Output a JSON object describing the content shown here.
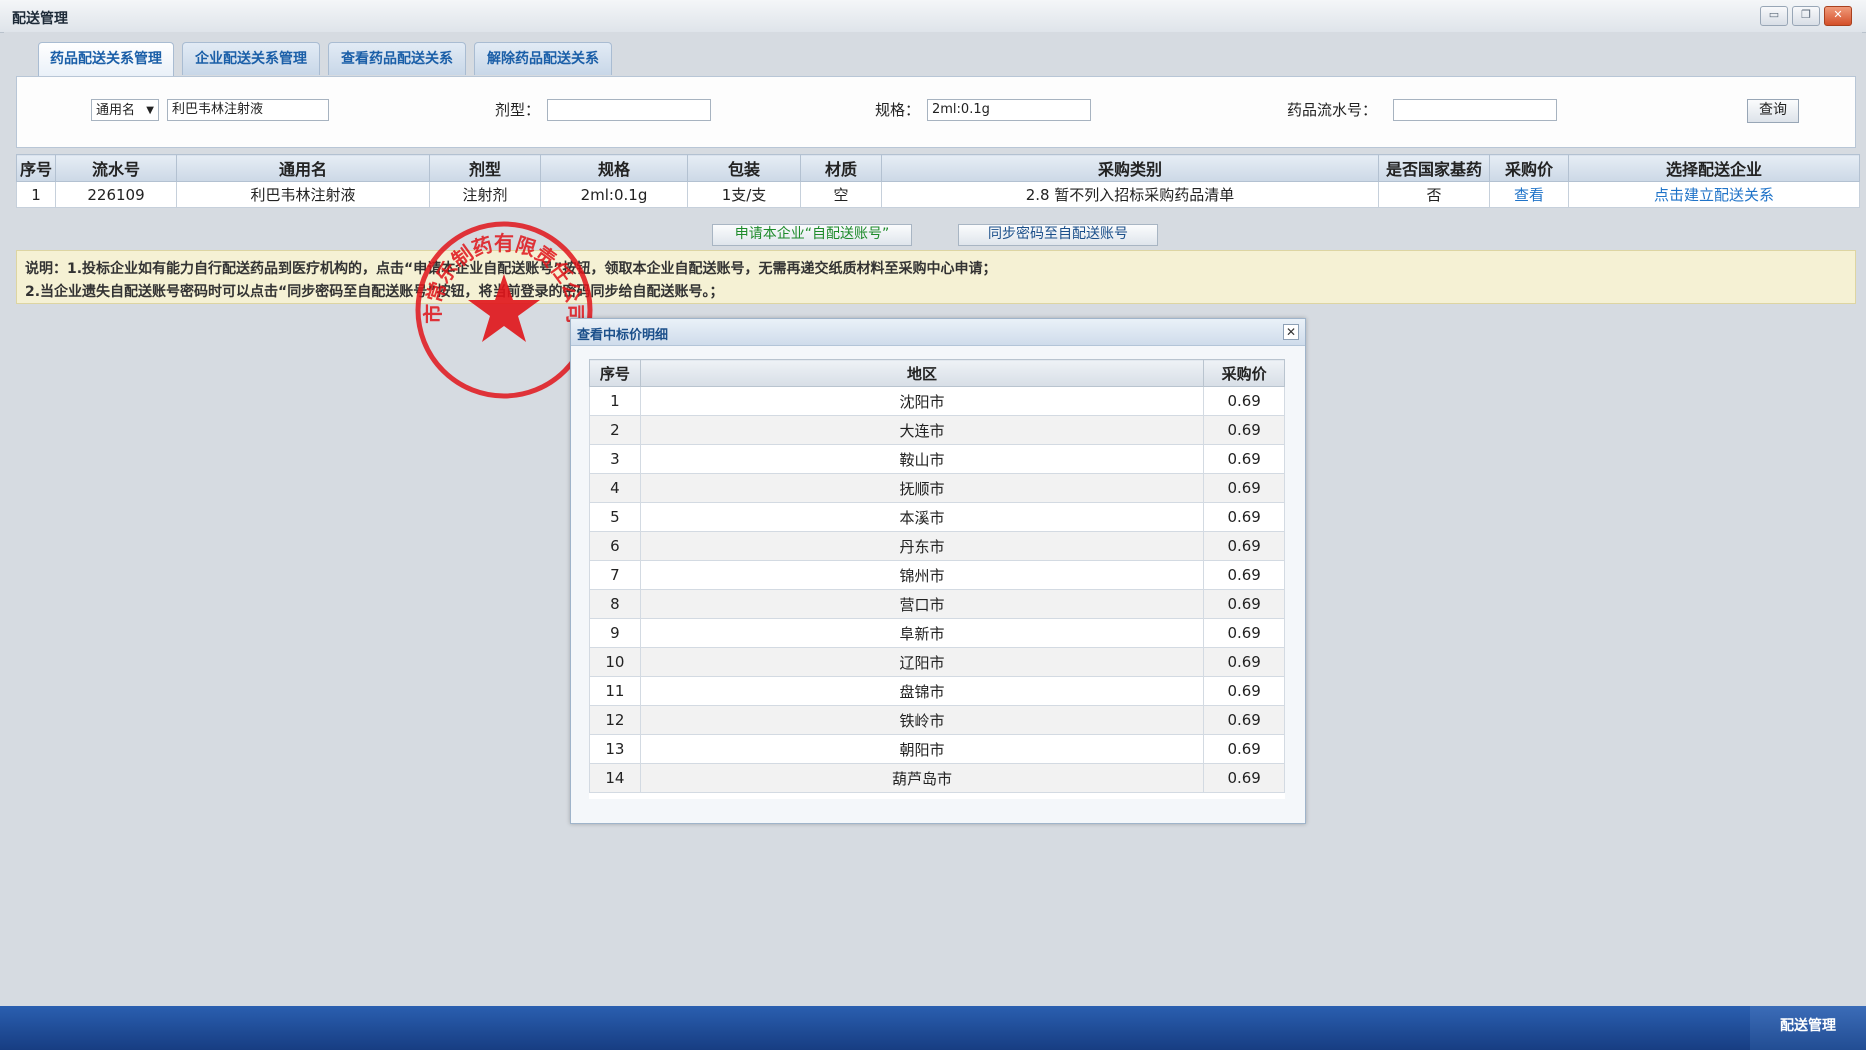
{
  "window": {
    "title": "配送管理",
    "minimize_icon": "minimize-icon",
    "maximize_icon": "maximize-icon",
    "close_icon": "close-icon"
  },
  "tabs": [
    {
      "label": "药品配送关系管理",
      "active": true
    },
    {
      "label": "企业配送关系管理",
      "active": false
    },
    {
      "label": "查看药品配送关系",
      "active": false
    },
    {
      "label": "解除药品配送关系",
      "active": false
    }
  ],
  "search": {
    "name_type_selected": "通用名",
    "name_value": "利巴韦林注射液",
    "dosage_label": "剂型：",
    "dosage_value": "",
    "spec_label": "规格：",
    "spec_value": "2ml:0.1g",
    "serial_label": "药品流水号：",
    "serial_value": "",
    "query_label": "查询"
  },
  "table": {
    "headers": [
      "序号",
      "流水号",
      "通用名",
      "剂型",
      "规格",
      "包装",
      "材质",
      "采购类别",
      "是否国家基药",
      "采购价",
      "选择配送企业"
    ],
    "rows": [
      {
        "index": "1",
        "serial": "226109",
        "name": "利巴韦林注射液",
        "dosage": "注射剂",
        "spec": "2ml:0.1g",
        "package": "1支/支",
        "material": "空",
        "category": "2.8 暂不列入招标采购药品清单",
        "basic_drug": "否",
        "price_link": "查看",
        "enterprise_link": "点击建立配送关系"
      }
    ]
  },
  "actions": {
    "apply_label": "申请本企业“自配送账号”",
    "sync_label": "同步密码至自配送账号"
  },
  "notice": {
    "line1": "说明：1.投标企业如有能力自行配送药品到医疗机构的，点击“申请本企业自配送账号”按钮，领取本企业自配送账号，无需再递交纸质材料至采购中心申请；",
    "line2": "2.当企业遗失自配送账号密码时可以点击“同步密码至自配送账号”按钮，将当前登录的密码同步给自配送账号。；"
  },
  "stamp": {
    "text": "市常乐制药有限责任公司",
    "color": "#e0141a"
  },
  "dialog": {
    "title": "查看中标价明细",
    "headers": [
      "序号",
      "地区",
      "采购价"
    ],
    "rows": [
      {
        "index": "1",
        "region": "沈阳市",
        "price": "0.69"
      },
      {
        "index": "2",
        "region": "大连市",
        "price": "0.69"
      },
      {
        "index": "3",
        "region": "鞍山市",
        "price": "0.69"
      },
      {
        "index": "4",
        "region": "抚顺市",
        "price": "0.69"
      },
      {
        "index": "5",
        "region": "本溪市",
        "price": "0.69"
      },
      {
        "index": "6",
        "region": "丹东市",
        "price": "0.69"
      },
      {
        "index": "7",
        "region": "锦州市",
        "price": "0.69"
      },
      {
        "index": "8",
        "region": "营口市",
        "price": "0.69"
      },
      {
        "index": "9",
        "region": "阜新市",
        "price": "0.69"
      },
      {
        "index": "10",
        "region": "辽阳市",
        "price": "0.69"
      },
      {
        "index": "11",
        "region": "盘锦市",
        "price": "0.69"
      },
      {
        "index": "12",
        "region": "铁岭市",
        "price": "0.69"
      },
      {
        "index": "13",
        "region": "朝阳市",
        "price": "0.69"
      },
      {
        "index": "14",
        "region": "葫芦岛市",
        "price": "0.69"
      }
    ]
  },
  "taskbar": {
    "item_label": "配送管理"
  },
  "colors": {
    "accent": "#1b5fa8",
    "link": "#1f73c8",
    "taskbar": "#1f4d98"
  }
}
